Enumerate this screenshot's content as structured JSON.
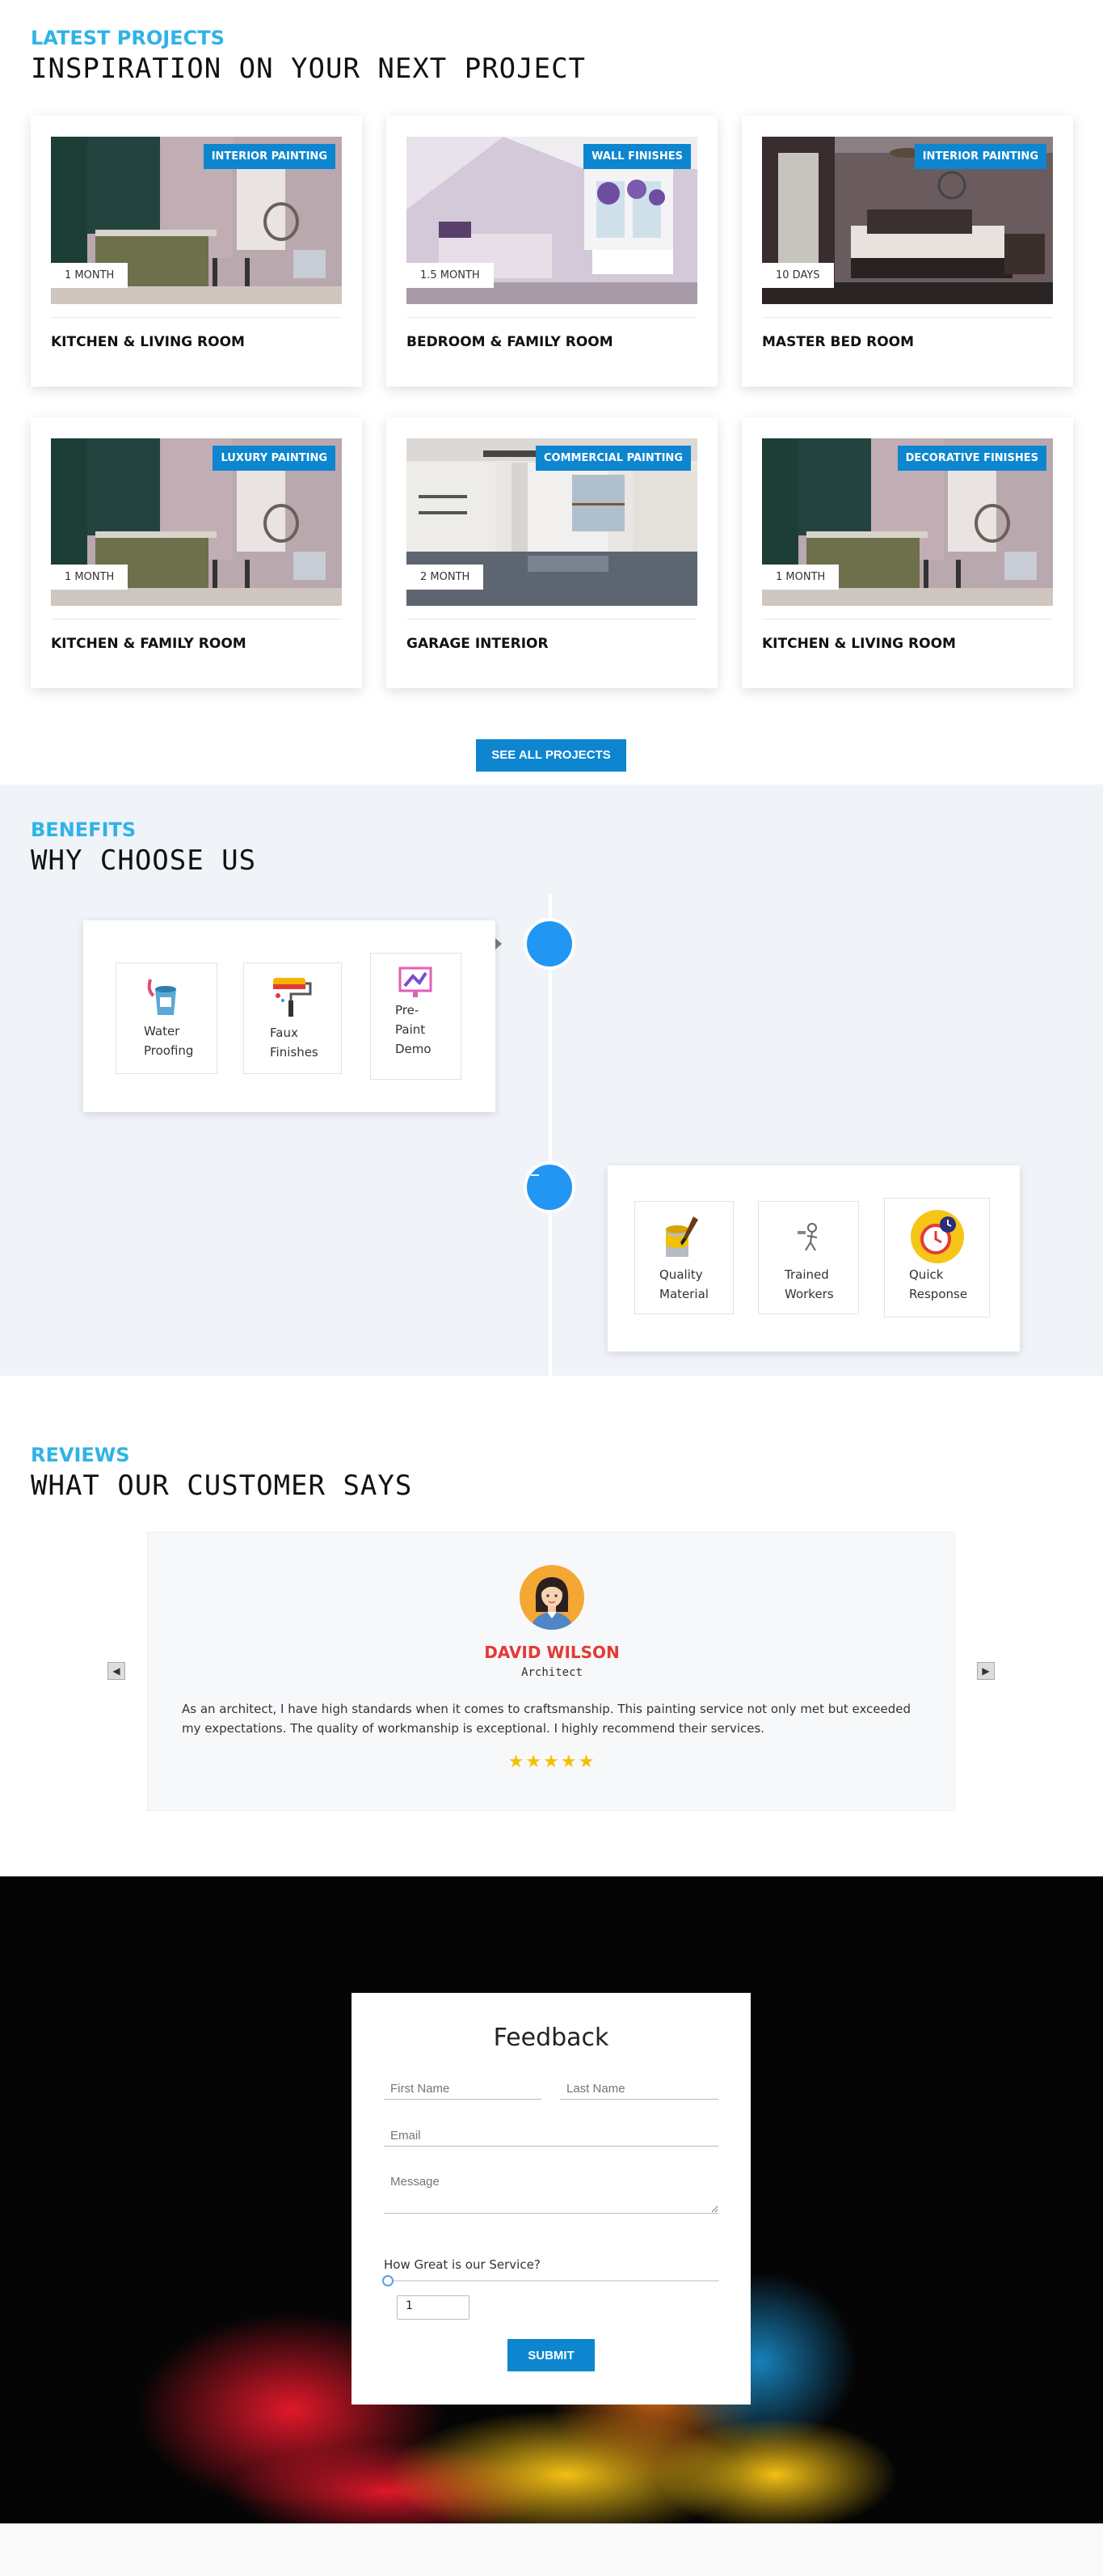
{
  "projects": {
    "kicker": "LATEST PROJECTS",
    "title": "INSPIRATION ON YOUR NEXT PROJECT",
    "cards": [
      {
        "tag": "INTERIOR PAINTING",
        "duration": "1 MONTH",
        "name": "KITCHEN & LIVING ROOM",
        "scene": "kitchen"
      },
      {
        "tag": "WALL FINISHES",
        "duration": "1.5 MONTH",
        "name": "BEDROOM & FAMILY ROOM",
        "scene": "bedroom"
      },
      {
        "tag": "INTERIOR PAINTING",
        "duration": "10 DAYS",
        "name": "MASTER BED ROOM",
        "scene": "master"
      },
      {
        "tag": "LUXURY PAINTING",
        "duration": "1 MONTH",
        "name": "KITCHEN & FAMILY ROOM",
        "scene": "kitchen"
      },
      {
        "tag": "COMMERCIAL PAINTING",
        "duration": "2 MONTH",
        "name": "GARAGE INTERIOR",
        "scene": "garage"
      },
      {
        "tag": "DECORATIVE FINISHES",
        "duration": "1 MONTH",
        "name": "KITCHEN & LIVING ROOM",
        "scene": "kitchen"
      }
    ],
    "see_all_label": "SEE ALL PROJECTS"
  },
  "benefits": {
    "kicker": "BENEFITS",
    "title": "WHY CHOOSE US",
    "group1": [
      {
        "label": "Water Proofing",
        "icon": "paint-bucket-icon"
      },
      {
        "label": "Faux Finishes",
        "icon": "paint-roller-icon"
      },
      {
        "label": "Pre-Paint Demo",
        "icon": "demo-screen-icon"
      }
    ],
    "group2": [
      {
        "label": "Quality Material",
        "icon": "paint-can-brush-icon"
      },
      {
        "label": "Trained Workers",
        "icon": "worker-icon"
      },
      {
        "label": "Quick Response",
        "icon": "alarm-clock-icon"
      }
    ]
  },
  "reviews": {
    "kicker": "REVIEWS",
    "title": "WHAT OUR CUSTOMER SAYS",
    "name": "DAVID WILSON",
    "role": "Architect",
    "text": "As an architect, I have high standards when it comes to craftsmanship. This painting service not only met but exceeded my expectations. The quality of workmanship is exceptional. I highly recommend their services.",
    "stars": "★★★★★",
    "rating": 5
  },
  "feedback": {
    "title": "Feedback",
    "first_name_placeholder": "First Name",
    "last_name_placeholder": "Last Name",
    "email_placeholder": "Email",
    "message_placeholder": "Message",
    "question": "How Great is our Service?",
    "rating_value": "1",
    "submit_label": "SUBMIT"
  },
  "colors": {
    "accent": "#0d86cf",
    "kicker": "#2fb3e6",
    "dot": "#2196f3",
    "reviewer": "#e53935",
    "star": "#f2c200"
  }
}
